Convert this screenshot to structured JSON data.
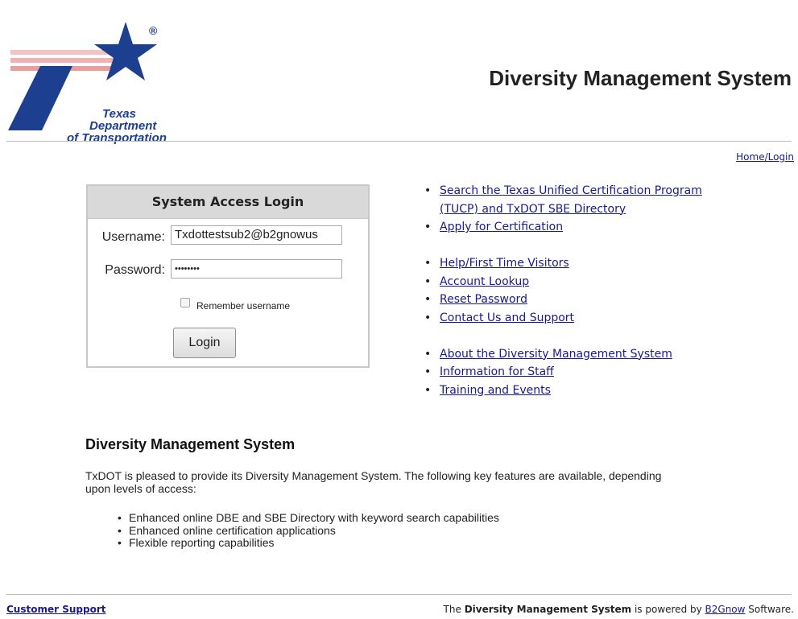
{
  "header": {
    "logo_lines": [
      "Texas",
      "Department",
      "of Transportation"
    ],
    "registered_mark": "®",
    "title": "Diversity Management System",
    "home_link": "Home/Login"
  },
  "login": {
    "title": "System Access Login",
    "username_label": "Username:",
    "username_value": "Txdottestsub2@b2gnowus",
    "password_label": "Password:",
    "password_value": "••••••••",
    "remember_label": "Remember username",
    "login_button": "Login"
  },
  "links": {
    "group1": [
      "Search the Texas Unified Certification Program (TUCP) and TxDOT SBE Directory",
      "Apply for Certification"
    ],
    "group2": [
      "Help/First Time Visitors",
      "Account Lookup",
      "Reset Password",
      "Contact Us and Support"
    ],
    "group3": [
      "About the Diversity Management System",
      "Information for Staff",
      "Training and Events"
    ]
  },
  "info": {
    "title": "Diversity Management System",
    "description": "TxDOT is pleased to provide its Diversity Management System. The following key features are available, depending upon levels of access:",
    "features": [
      "Enhanced online DBE and SBE Directory with keyword search capabilities",
      "Enhanced online certification applications",
      "Flexible reporting capabilities"
    ]
  },
  "footer": {
    "customer_support": "Customer Support",
    "powered_prefix": "The ",
    "powered_bold": "Diversity Management System",
    "powered_middle": " is powered by ",
    "powered_link": "B2Gnow",
    "powered_suffix": " Software."
  },
  "colors": {
    "logo_blue": "#1d3f8f",
    "logo_stripes": "#e8a3a3",
    "link": "#1a1a8c"
  }
}
